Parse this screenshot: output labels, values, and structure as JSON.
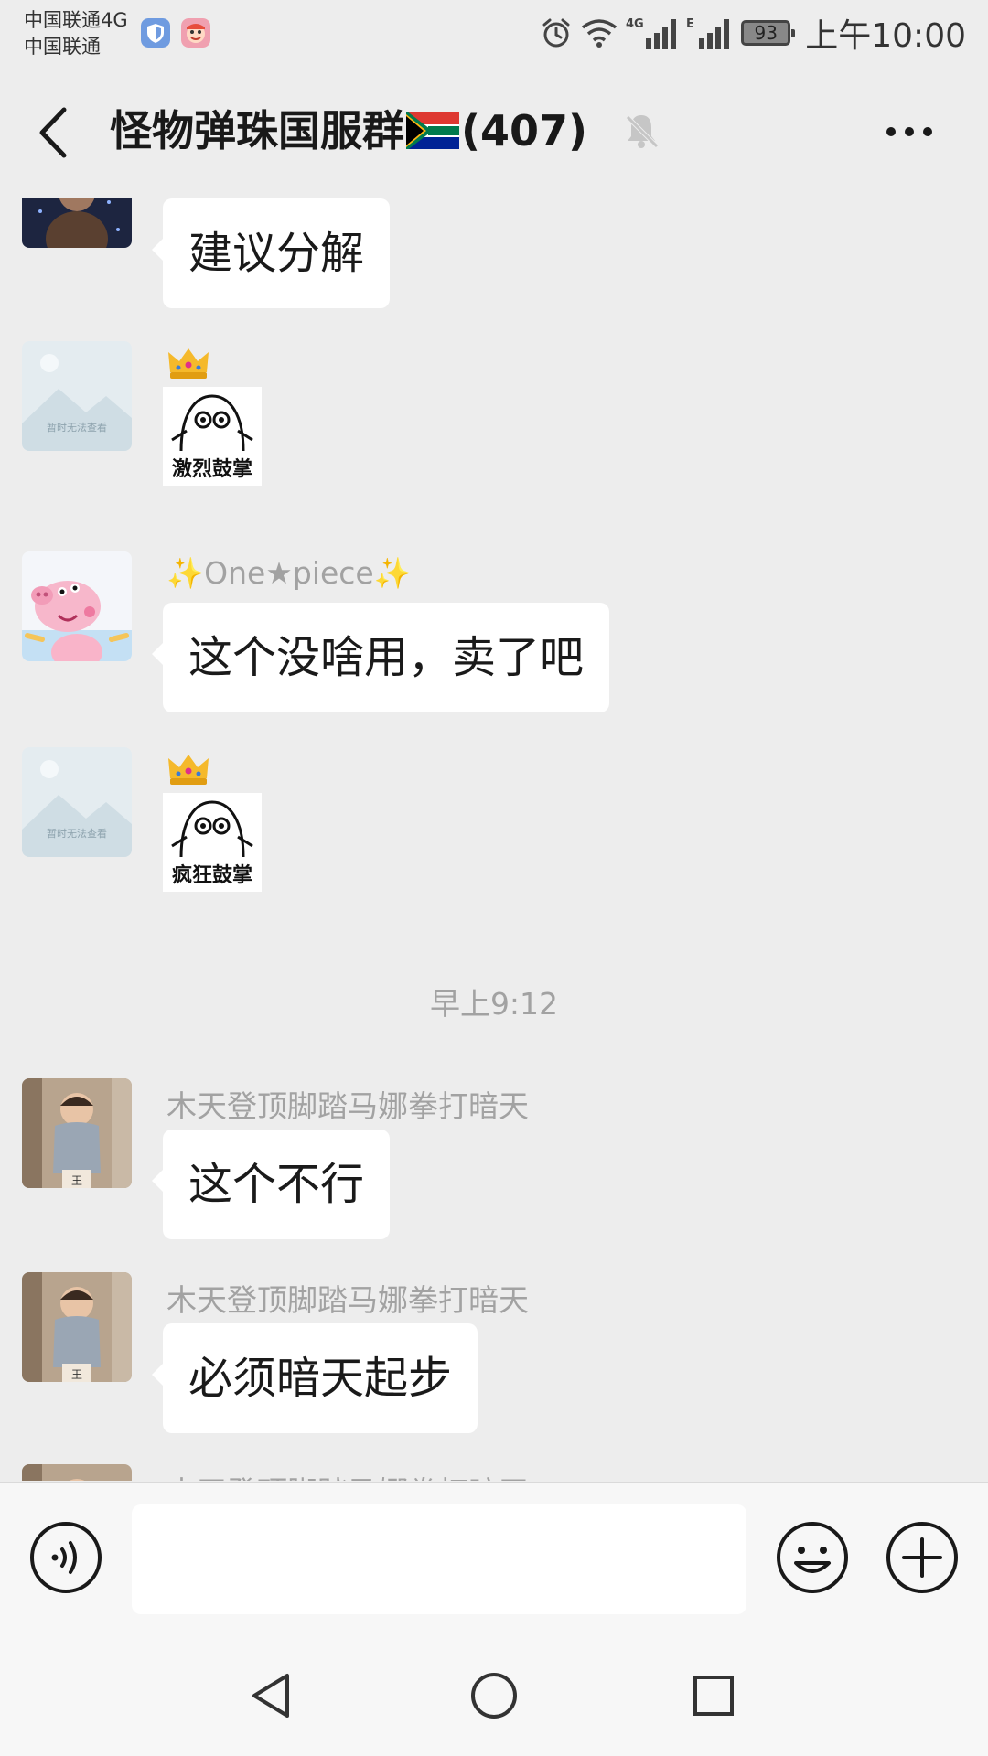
{
  "status_bar": {
    "carrier_line1": "中国联通4G",
    "carrier_line2": "中国联通",
    "network_label": "4G",
    "network_label2": "E",
    "battery": "93",
    "time": "上午10:00"
  },
  "header": {
    "title_prefix": "怪物弹珠国服群",
    "title_suffix": "(407)",
    "icons": [
      "back-icon",
      "flag-icon",
      "mute-icon",
      "more-icon"
    ]
  },
  "messages": [
    {
      "type": "text",
      "sender": "",
      "text": "建议分解",
      "avatar": "photo"
    },
    {
      "type": "sticker",
      "sender_icon": "crown",
      "caption": "激烈鼓掌",
      "avatar": "placeholder",
      "avatar_text": "暂时无法查看"
    },
    {
      "type": "text",
      "sender": "✨One★piece✨",
      "text": "这个没啥用，卖了吧",
      "avatar": "peppa"
    },
    {
      "type": "sticker",
      "sender_icon": "crown",
      "caption": "疯狂鼓掌",
      "avatar": "placeholder",
      "avatar_text": "暂时无法查看"
    },
    {
      "type": "time",
      "text": "早上9:12"
    },
    {
      "type": "text",
      "sender": "木天登顶脚踏马娜拳打暗天",
      "text": "这个不行",
      "avatar": "kid"
    },
    {
      "type": "text",
      "sender": "木天登顶脚踏马娜拳打暗天",
      "text": "必须暗天起步",
      "avatar": "kid"
    },
    {
      "type": "partial",
      "sender": "木天登顶脚踏马娜拳打暗天",
      "avatar": "kid"
    }
  ],
  "input_bar": {
    "placeholder": "",
    "icons": [
      "voice-icon",
      "emoji-icon",
      "plus-icon"
    ]
  },
  "system_nav": {
    "icons": [
      "nav-back-icon",
      "nav-home-icon",
      "nav-recents-icon"
    ]
  },
  "colors": {
    "background": "#ededed",
    "bubble": "#ffffff",
    "secondary_text": "#a2a2a2"
  }
}
